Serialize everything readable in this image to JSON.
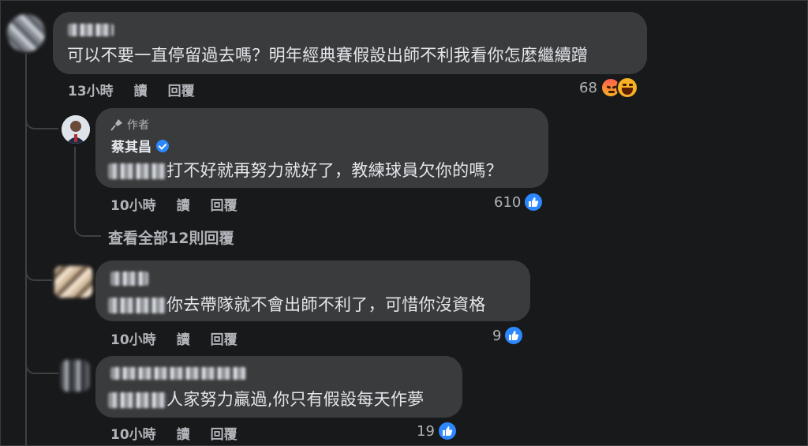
{
  "comments": [
    {
      "text": "可以不要一直停留過去嗎？明年經典賽假設出師不利我看你怎麼繼續蹭",
      "time": "13小時",
      "read_label": "讀",
      "reply_label": "回覆",
      "reaction_count": "68",
      "reactions": [
        "angry-icon",
        "haha-icon"
      ]
    },
    {
      "author_badge": "作者",
      "author_name": "蔡其昌",
      "text": "打不好就再努力就好了，教練球員欠你的嗎？",
      "time": "10小時",
      "read_label": "讀",
      "reply_label": "回覆",
      "reaction_count": "610",
      "reactions": [
        "like-icon"
      ]
    },
    {
      "text": "你去帶隊就不會出師不利了，可惜你沒資格",
      "time": "10小時",
      "read_label": "讀",
      "reply_label": "回覆",
      "reaction_count": "9",
      "reactions": [
        "like-icon"
      ]
    },
    {
      "text": "人家努力贏過,你只有假設每天作夢",
      "time": "10小時",
      "read_label": "讀",
      "reply_label": "回覆",
      "reaction_count": "19",
      "reactions": [
        "like-icon"
      ]
    }
  ],
  "view_all_replies": "查看全部12則回覆",
  "colors": {
    "background": "#18191a",
    "bubble": "#3a3b3c",
    "like_blue": "#2d88ff",
    "secondary_text": "#b0b3b8"
  }
}
